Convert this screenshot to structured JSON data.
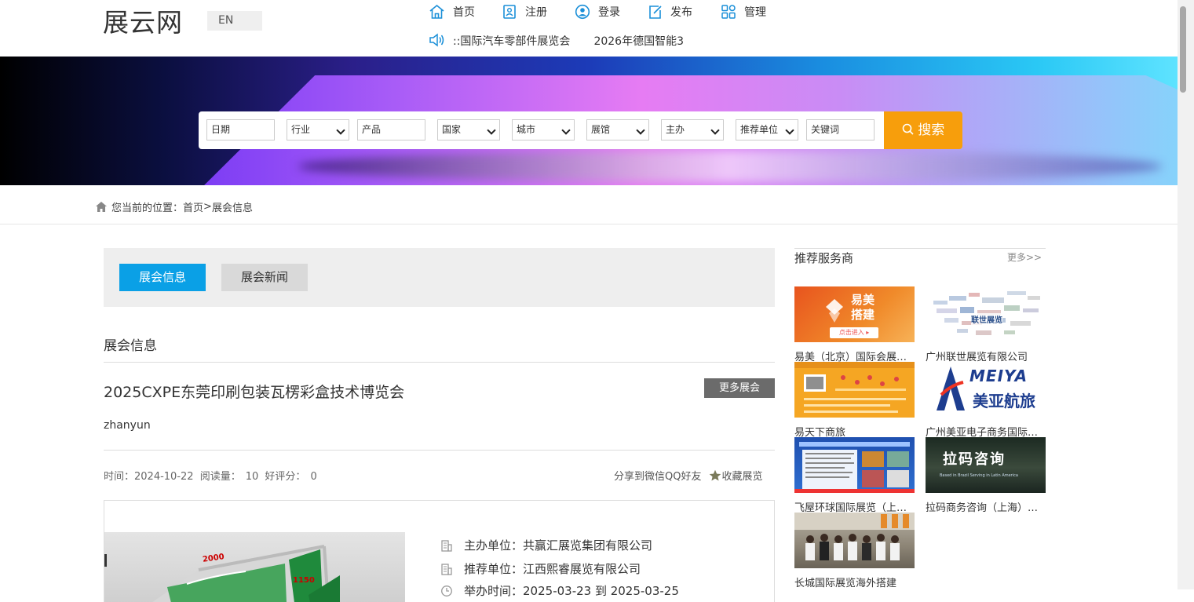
{
  "header": {
    "logo": "展云网",
    "lang_label": "EN",
    "nav": [
      {
        "label": "首页",
        "icon": "home-icon"
      },
      {
        "label": "注册",
        "icon": "register-icon"
      },
      {
        "label": "登录",
        "icon": "user-icon"
      },
      {
        "label": "发布",
        "icon": "edit-icon"
      },
      {
        "label": "管理",
        "icon": "grid-icon"
      }
    ],
    "ticker": [
      "::国际汽车零部件展览会",
      "2026年德国智能3"
    ]
  },
  "search": {
    "date_placeholder": "日期",
    "industry": "行业",
    "product_placeholder": "产品",
    "country": "国家",
    "city": "城市",
    "venue": "展馆",
    "organizer": "主办",
    "recommender": "推荐单位",
    "keyword_placeholder": "关键词",
    "button_label": "搜索",
    "accent_color": "#f79e0c"
  },
  "breadcrumb": {
    "prefix": "您当前的位置：",
    "home": "首页",
    "sep": ">",
    "current": "展会信息"
  },
  "tabs": [
    {
      "label": "展会信息",
      "active": true
    },
    {
      "label": "展会新闻",
      "active": false
    }
  ],
  "section_title": "展会信息",
  "event": {
    "title": "2025CXPE东莞印刷包装瓦楞彩盒技术博览会",
    "more_button": "更多展会",
    "author": "zhanyun",
    "time_label": "时间：",
    "time": "2024-10-22",
    "reads_label": "阅读量：",
    "reads": "10",
    "rating_label": "好评分：",
    "rating": "0",
    "share": "分享到微信QQ好友",
    "favorite": "收藏展览",
    "thumb_labels": [
      "2000",
      "1150"
    ],
    "info": [
      {
        "label": "主办单位：",
        "value": "共赢汇展览集团有限公司"
      },
      {
        "label": "推荐单位：",
        "value": "江西熙睿展览有限公司"
      },
      {
        "label": "举办时间：",
        "value": "2025-03-23 到 2025-03-25"
      }
    ]
  },
  "sidebar": {
    "title": "推荐服务商",
    "more": "更多>>",
    "cards": [
      {
        "caption": "易美（北京）国际会展服务有限公司",
        "img_text": "易美\n搭建",
        "img_sub": "点击进入 ▸"
      },
      {
        "caption": "广州联世展览有限公司",
        "img_text": "联世展览"
      },
      {
        "caption": "易天下商旅",
        "img_text": ""
      },
      {
        "caption": "广州美亚电子商务国际旅行社有限公司",
        "img_text": "MEIYA",
        "img_sub": "美亚航旅"
      },
      {
        "caption": "飞屋环球国际展览（上海）有限公司",
        "img_text": ""
      },
      {
        "caption": "拉码商务咨询（上海）有限公司",
        "img_text": "拉码咨询",
        "img_sub": "Based in Brazil  Serving in Latin America"
      },
      {
        "caption": "长城国际展览海外搭建",
        "img_text": ""
      }
    ]
  }
}
